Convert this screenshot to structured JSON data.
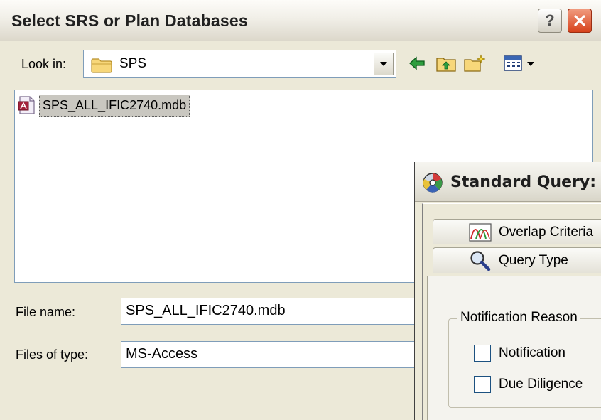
{
  "file_dialog": {
    "title": "Select SRS or Plan Databases",
    "help_glyph": "?",
    "close_glyph": "X",
    "look_in_label": "Look in:",
    "look_in_value": "SPS",
    "files": [
      {
        "name": "SPS_ALL_IFIC2740.mdb",
        "icon": "access-db-icon",
        "selected": true
      }
    ],
    "file_name_label": "File name:",
    "file_name_value": "SPS_ALL_IFIC2740.mdb",
    "files_of_type_label": "Files of type:",
    "files_of_type_value": "MS-Access",
    "toolbar_icons": [
      "back-arrow-icon",
      "up-folder-icon",
      "new-folder-icon",
      "view-menu-icon"
    ]
  },
  "query_dialog": {
    "title": "Standard Query:",
    "tabs": [
      {
        "label": "Overlap Criteria",
        "icon": "overlap-curves-icon"
      },
      {
        "label": "Query Type",
        "icon": "magnifier-icon"
      }
    ],
    "group_label": "Notification Reason",
    "checkboxes": [
      {
        "label": "Notification",
        "checked": false
      },
      {
        "label": "Due Diligence",
        "checked": false
      }
    ]
  },
  "colors": {
    "window_bg": "#ece9d8",
    "selection_bg": "#c9c7c0",
    "close_red": "#d7421b",
    "field_border": "#7f9db9",
    "arrow_green": "#2e9e3e"
  }
}
